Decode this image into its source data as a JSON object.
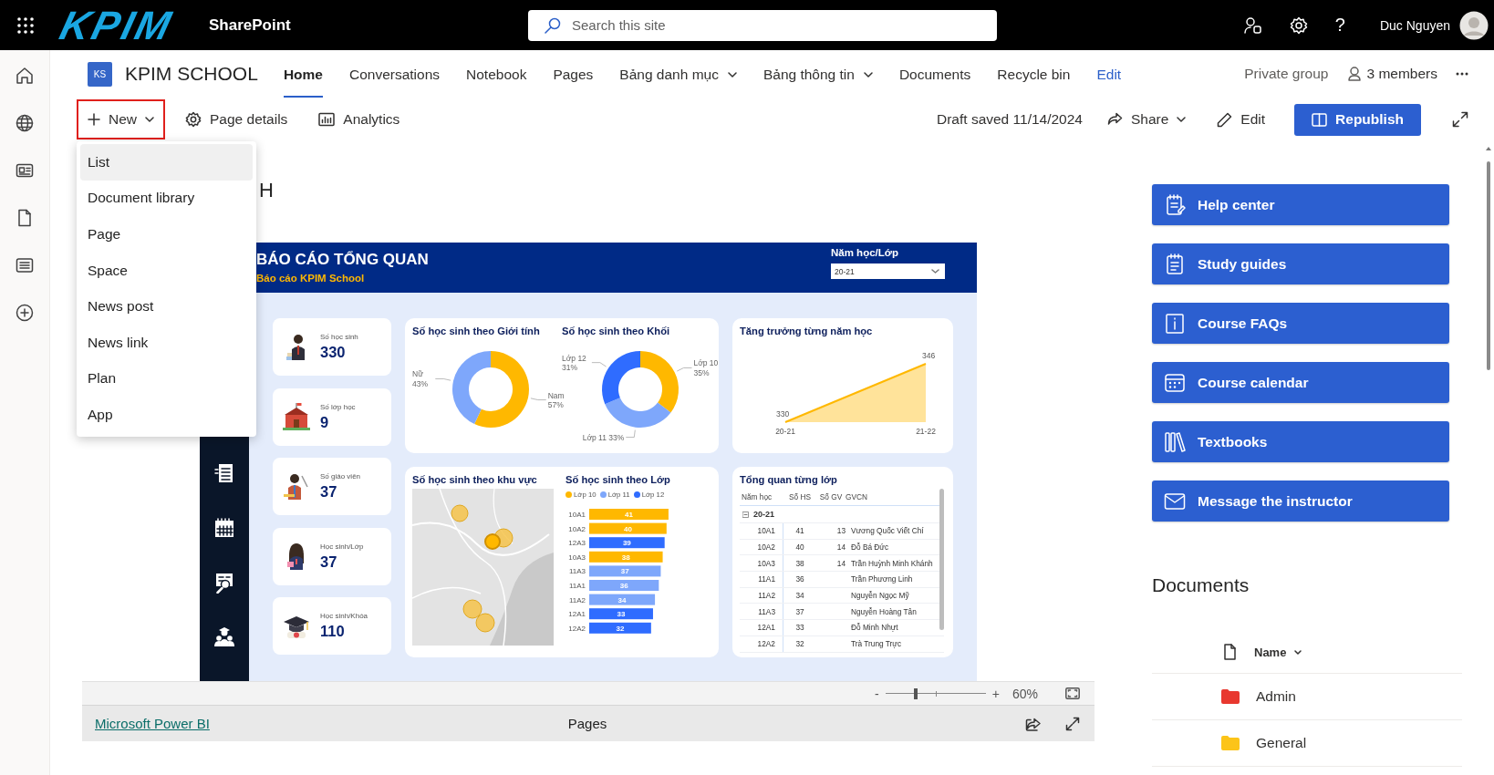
{
  "top_bar": {
    "logo": "KPIM",
    "app_name": "SharePoint",
    "search": {
      "placeholder": "Search this site"
    },
    "help": "?",
    "user_name": "Duc Nguyen"
  },
  "site": {
    "badge": "KS",
    "name": "KPIM SCHOOL",
    "nav": [
      {
        "label": "Home",
        "selected": true,
        "kind": "link"
      },
      {
        "label": "Conversations",
        "selected": false,
        "kind": "link"
      },
      {
        "label": "Notebook",
        "selected": false,
        "kind": "link"
      },
      {
        "label": "Pages",
        "selected": false,
        "kind": "link"
      },
      {
        "label": "Bảng danh mục",
        "selected": false,
        "kind": "menu"
      },
      {
        "label": "Bảng thông tin",
        "selected": false,
        "kind": "menu"
      },
      {
        "label": "Documents",
        "selected": false,
        "kind": "link"
      },
      {
        "label": "Recycle bin",
        "selected": false,
        "kind": "link"
      },
      {
        "label": "Edit",
        "selected": false,
        "kind": "action"
      }
    ],
    "privacy": "Private group",
    "members": "3 members"
  },
  "command_bar": {
    "left": [
      {
        "label": "New",
        "kind": "new",
        "highlighted": true
      },
      {
        "label": "Page details",
        "kind": "details",
        "highlighted": false
      },
      {
        "label": "Analytics",
        "kind": "analytics",
        "highlighted": false
      }
    ],
    "status": "Draft saved 11/14/2024",
    "right": [
      {
        "label": "Share",
        "kind": "share"
      },
      {
        "label": "Edit",
        "kind": "edit"
      },
      {
        "label": "Republish",
        "kind": "primary"
      }
    ]
  },
  "new_menu": {
    "items": [
      {
        "label": "List",
        "highlighted": true
      },
      {
        "label": "Document library",
        "highlighted": false
      },
      {
        "label": "Page",
        "highlighted": false
      },
      {
        "label": "Space",
        "highlighted": false
      },
      {
        "label": "News post",
        "highlighted": false
      },
      {
        "label": "News link",
        "highlighted": false
      },
      {
        "label": "Plan",
        "highlighted": false
      },
      {
        "label": "App",
        "highlighted": false
      }
    ]
  },
  "page_title": "H",
  "report": {
    "title": "BÁO CÁO TỔNG QUAN",
    "subtitle": "Báo cáo KPIM School",
    "slicer": {
      "label": "Năm học/Lớp",
      "value": "20-21"
    },
    "kpis": [
      {
        "label": "Số học sinh",
        "value": "330"
      },
      {
        "label": "Số lớp học",
        "value": "9"
      },
      {
        "label": "Số giáo viên",
        "value": "37"
      },
      {
        "label": "Học sinh/Lớp",
        "value": "37"
      },
      {
        "label": "Học sinh/Khóa",
        "value": "110"
      }
    ],
    "gender_panel": {
      "chart_data": {
        "type": "donut",
        "title": "Số học sinh theo Giới tính",
        "categories": [
          "Nam",
          "Nữ"
        ],
        "values": [
          57,
          43
        ],
        "colors": [
          "#ffb800",
          "#7ea7fb"
        ],
        "value_labels": [
          "57%",
          "43%"
        ]
      }
    },
    "grade_panel": {
      "chart_data": {
        "type": "donut",
        "title": "Số học sinh theo Khối",
        "categories": [
          "Lớp 10",
          "Lớp 11",
          "Lớp 12"
        ],
        "values": [
          35,
          33,
          31
        ],
        "colors": [
          "#ffb800",
          "#7ea7fb",
          "#2f6cff"
        ],
        "value_labels": [
          "35%",
          "33%",
          "31%"
        ]
      }
    },
    "growth_panel": {
      "chart_data": {
        "type": "area",
        "title": "Tăng trưởng từng năm học",
        "categories": [
          "20-21",
          "21-22"
        ],
        "values": [
          330,
          346
        ],
        "data_labels": true
      }
    },
    "map_panel": {
      "title": "Số học sinh theo khu vực",
      "kind": "picture"
    },
    "class_panel": {
      "chart_data": {
        "type": "bar",
        "title": "Số học sinh theo Lớp",
        "orientation": "horizontal",
        "stacked": true,
        "data_labels": true,
        "legend": "top",
        "categories": [
          "10A1",
          "10A2",
          "12A3",
          "10A3",
          "11A3",
          "11A1",
          "11A2",
          "12A1",
          "12A2"
        ],
        "series": [
          {
            "name": "Lớp 10",
            "color": "#ffb800",
            "values": [
              41,
              40,
              null,
              38,
              null,
              null,
              null,
              null,
              null
            ]
          },
          {
            "name": "Lớp 11",
            "color": "#7ea7fb",
            "values": [
              null,
              null,
              null,
              null,
              37,
              36,
              34,
              null,
              null
            ]
          },
          {
            "name": "Lớp 12",
            "color": "#2f6cff",
            "values": [
              null,
              null,
              39,
              null,
              null,
              null,
              null,
              33,
              32
            ]
          }
        ]
      }
    },
    "class_table": {
      "title": "Tổng quan từng lớp",
      "columns": [
        "Năm học",
        "Số HS",
        "Số GV",
        "GVCN"
      ],
      "groups": [
        {
          "label": "20-21",
          "expanded": true,
          "rows": [
            {
              "class": "10A1",
              "students": "41",
              "teachers": "13",
              "homeroom": "Vương Quốc Viết Chí"
            },
            {
              "class": "10A2",
              "students": "40",
              "teachers": "14",
              "homeroom": "Đỗ Bá Đức"
            },
            {
              "class": "10A3",
              "students": "38",
              "teachers": "14",
              "homeroom": "Trần Huỳnh Minh Khánh"
            },
            {
              "class": "11A1",
              "students": "36",
              "homeroom": "Trần Phương Linh"
            },
            {
              "class": "11A2",
              "students": "34",
              "homeroom": "Nguyễn Ngọc Mỹ"
            },
            {
              "class": "11A3",
              "students": "37",
              "homeroom": "Nguyễn Hoàng Tân"
            },
            {
              "class": "12A1",
              "students": "33",
              "homeroom": "Đỗ Minh Nhựt"
            },
            {
              "class": "12A2",
              "students": "32",
              "homeroom": "Trà Trung Trực"
            }
          ]
        }
      ]
    },
    "zoom": {
      "minus": "-",
      "plus": "+",
      "level": 0.3,
      "reading": "60%"
    },
    "footer": {
      "link": "Microsoft Power BI",
      "pages": "Pages"
    }
  },
  "quick_links": [
    {
      "label": "Help center"
    },
    {
      "label": "Study guides"
    },
    {
      "label": "Course FAQs"
    },
    {
      "label": "Course calendar"
    },
    {
      "label": "Textbooks"
    },
    {
      "label": "Message the instructor"
    }
  ],
  "documents": {
    "title": "Documents",
    "column": "Name",
    "items": [
      {
        "name": "Admin",
        "color": "#e8382f"
      },
      {
        "name": "General",
        "color": "#fcc419"
      }
    ]
  }
}
